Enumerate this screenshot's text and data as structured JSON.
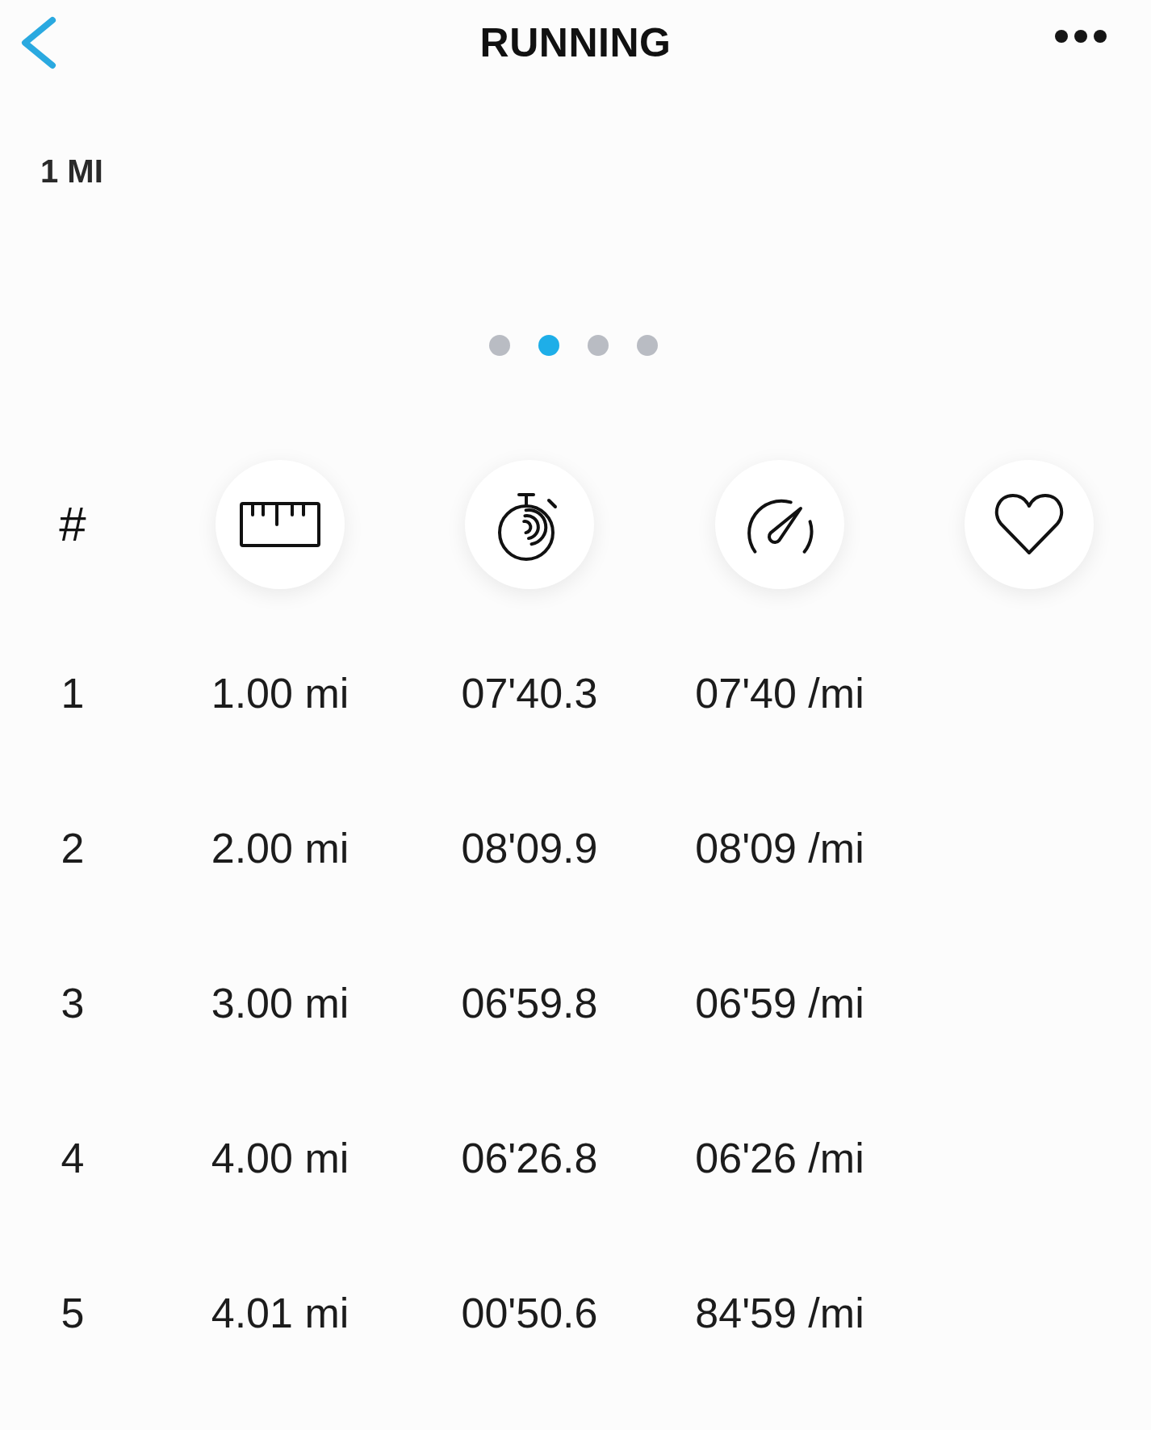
{
  "top_bar": {
    "title": "RUNNING"
  },
  "lap_filter": {
    "label": "1 MI"
  },
  "pager": {
    "pages": [
      {
        "selected": false
      },
      {
        "selected": true
      },
      {
        "selected": false
      },
      {
        "selected": false
      }
    ]
  },
  "table": {
    "index_heading": "#",
    "rows": [
      {
        "lap": "1",
        "distance": "1.00 mi",
        "time": "07'40.3",
        "pace": "07'40 /mi"
      },
      {
        "lap": "2",
        "distance": "2.00 mi",
        "time": "08'09.9",
        "pace": "08'09 /mi"
      },
      {
        "lap": "3",
        "distance": "3.00 mi",
        "time": "06'59.8",
        "pace": "06'59 /mi"
      },
      {
        "lap": "4",
        "distance": "4.00 mi",
        "time": "06'26.8",
        "pace": "06'26 /mi"
      },
      {
        "lap": "5",
        "distance": "4.01 mi",
        "time": "00'50.6",
        "pace": "84'59 /mi"
      }
    ]
  }
}
